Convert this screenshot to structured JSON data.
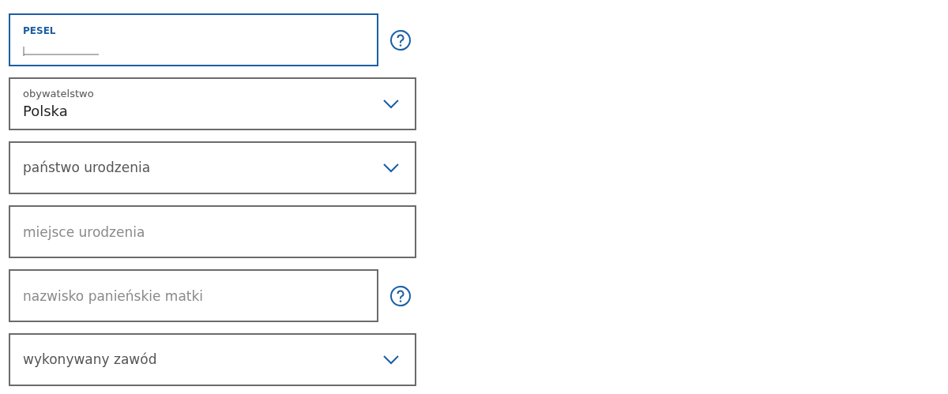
{
  "fields": [
    {
      "kind": "text",
      "label": "PESEL",
      "focused": true,
      "help": true
    },
    {
      "kind": "select",
      "label": "obywatelstwo",
      "value": "Polska",
      "focused": false,
      "help": false
    },
    {
      "kind": "select",
      "label": "państwo urodzenia",
      "focused": false,
      "help": false
    },
    {
      "kind": "text",
      "placeholder": "miejsce urodzenia",
      "focused": false,
      "help": false
    },
    {
      "kind": "text",
      "placeholder": "nazwisko panieńskie matki",
      "focused": false,
      "help": true
    },
    {
      "kind": "select",
      "label": "wykonywany zawód",
      "focused": false,
      "help": false
    }
  ]
}
